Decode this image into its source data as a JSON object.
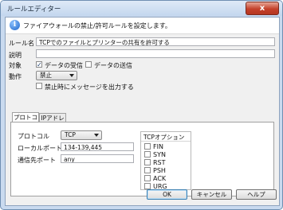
{
  "window": {
    "title": "ルールエディター",
    "close_glyph": "x"
  },
  "banner": {
    "text": "ファイアウォールの禁止/許可ルールを設定します。",
    "icon": "info-icon"
  },
  "form": {
    "rule_name_label": "ルール名",
    "rule_name_value": "TCPでのファイルとプリンターの共有を許可する",
    "description_label": "説明",
    "description_value": "",
    "target_label": "対象",
    "receive_label": "データの受信",
    "receive_checked": true,
    "send_label": "データの送信",
    "send_checked": false,
    "action_label": "動作",
    "action_value": "禁止",
    "log_label": "禁止時にメッセージを出力する",
    "log_checked": false
  },
  "tabs": [
    {
      "label": "プロトコル",
      "active": true
    },
    {
      "label": "IPアドレス",
      "active": false
    }
  ],
  "protocol": {
    "protocol_label": "プロトコル",
    "protocol_value": "TCP",
    "local_port_label": "ローカルポート",
    "local_port_value": "134-139,445",
    "remote_port_label": "通信先ポート",
    "remote_port_value": "any"
  },
  "tcp_options": {
    "title": "TCPオプション",
    "items": [
      {
        "label": "FIN",
        "checked": false
      },
      {
        "label": "SYN",
        "checked": false
      },
      {
        "label": "RST",
        "checked": false
      },
      {
        "label": "PSH",
        "checked": false
      },
      {
        "label": "ACK",
        "checked": false
      },
      {
        "label": "URG",
        "checked": false
      }
    ]
  },
  "buttons": {
    "ok": "OK",
    "cancel": "キャンセル",
    "help": "ヘルプ"
  }
}
